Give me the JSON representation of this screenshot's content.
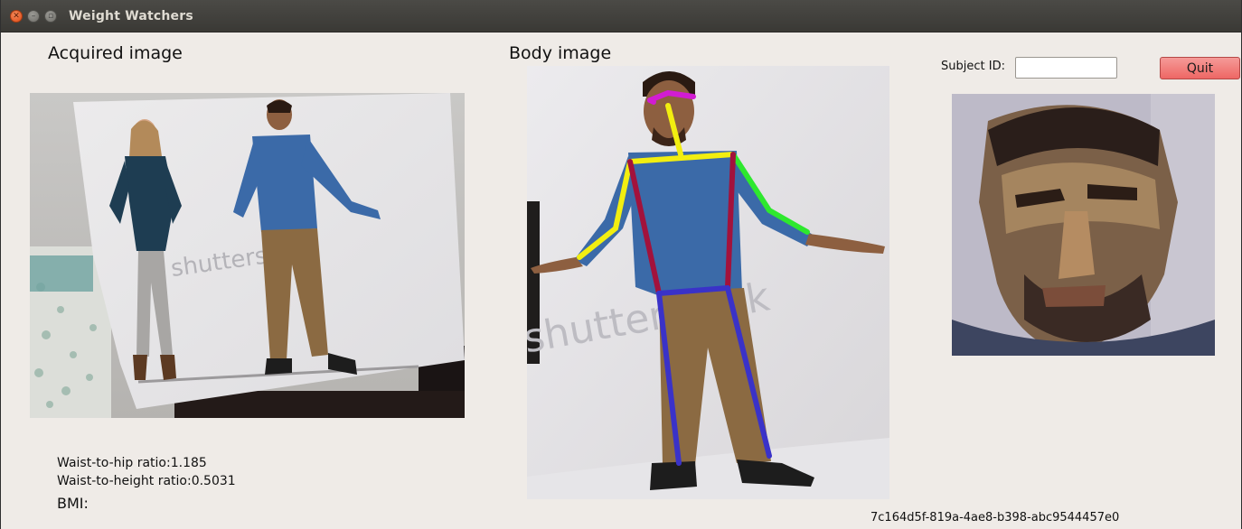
{
  "window": {
    "title": "Weight Watchers"
  },
  "acquired": {
    "title": "Acquired image",
    "watermark": "shutterstock"
  },
  "body": {
    "title": "Body image",
    "watermark": "shutterstock"
  },
  "subject": {
    "label": "Subject ID:",
    "value": "",
    "placeholder": ""
  },
  "quit_label": "Quit",
  "stats": {
    "waist_hip": "Waist-to-hip ratio:1.185",
    "waist_height": "Waist-to-height ratio:0.5031",
    "bmi": "BMI:"
  },
  "session_id": "7c164d5f-819a-4ae8-b398-abc9544457e0",
  "colors": {
    "quit_button": "#ee6764",
    "skeleton_head": "#d21cd2",
    "skeleton_yellow": "#f2ee10",
    "skeleton_green": "#2ee82e",
    "skeleton_torso": "#a2123c",
    "skeleton_legs": "#3a32c8"
  }
}
